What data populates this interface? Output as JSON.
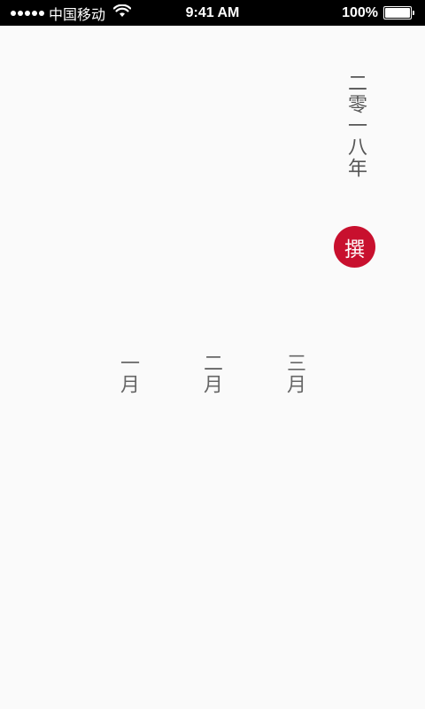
{
  "status_bar": {
    "carrier": "中国移动",
    "time": "9:41 AM",
    "battery_percent": "100%",
    "signal_icon": "signal-dots-icon",
    "wifi_icon": "wifi-icon",
    "battery_icon": "battery-icon"
  },
  "year": "二零一八年",
  "seal_button_label": "撰",
  "months": [
    "一月",
    "二月",
    "三月"
  ],
  "colors": {
    "background": "#fafafa",
    "accent": "#c8102e",
    "text": "#555555"
  }
}
